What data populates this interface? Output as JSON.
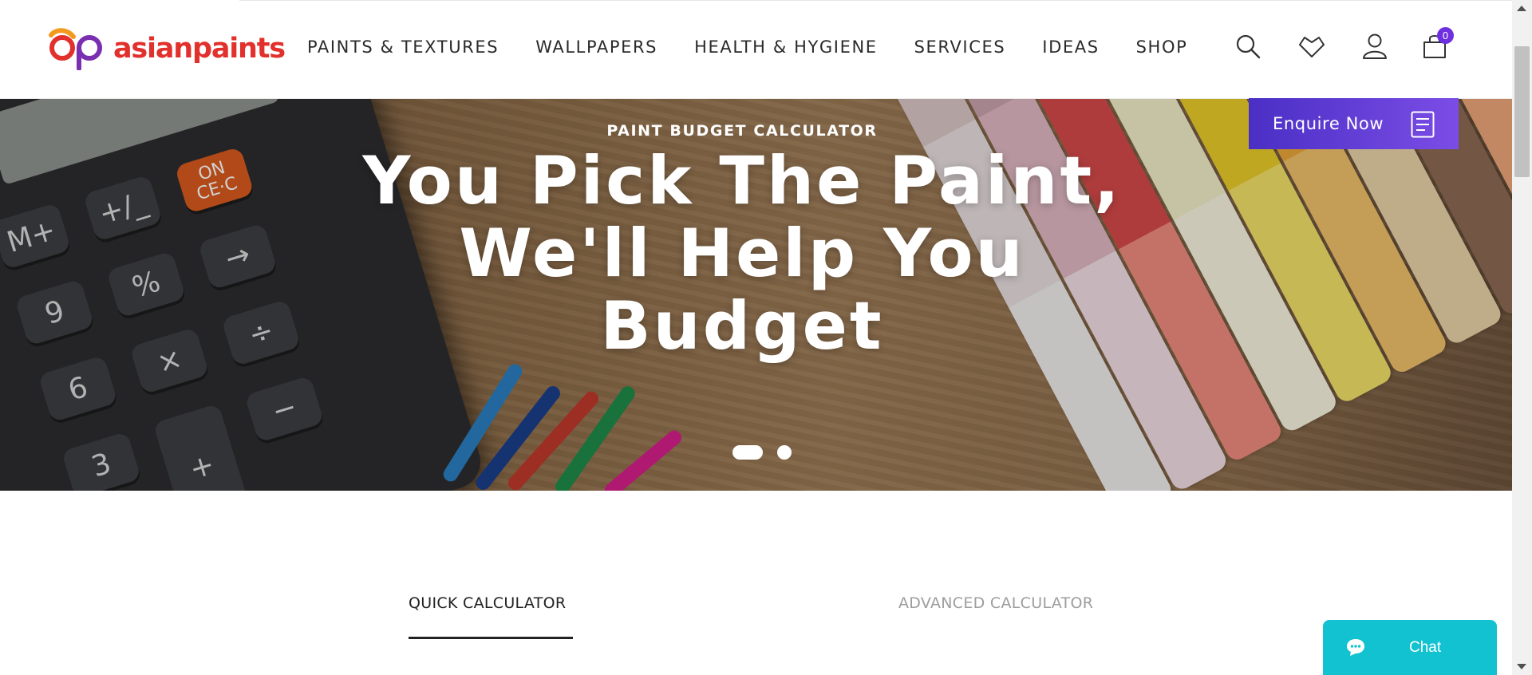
{
  "brand": {
    "name": "asianpaints",
    "color": "#e2302c"
  },
  "nav": {
    "items": [
      "PAINTS & TEXTURES",
      "WALLPAPERS",
      "HEALTH & HYGIENE",
      "SERVICES",
      "IDEAS",
      "SHOP"
    ]
  },
  "header_icons": {
    "search": "search-icon",
    "wishlist": "heart-icon",
    "account": "user-icon",
    "cart": "cart-icon"
  },
  "cart": {
    "count": "0"
  },
  "hero": {
    "subtitle": "PAINT BUDGET CALCULATOR",
    "title_lines": [
      "You Pick The Paint,",
      "We'll Help You",
      "Budget"
    ],
    "calculator_keys": [
      "M+",
      "+/_",
      "ON CE·C",
      "9",
      "%",
      "→",
      "6",
      "×",
      "÷",
      "3",
      "+",
      "−",
      "."
    ],
    "slides_total": 2,
    "active_slide": 1
  },
  "enquire": {
    "label": "Enquire Now",
    "accent": "#5b36d6"
  },
  "tabs": {
    "quick": "QUICK CALCULATOR",
    "advanced": "ADVANCED CALCULATOR"
  },
  "chat": {
    "label": "Chat",
    "color": "#13c2d0"
  }
}
